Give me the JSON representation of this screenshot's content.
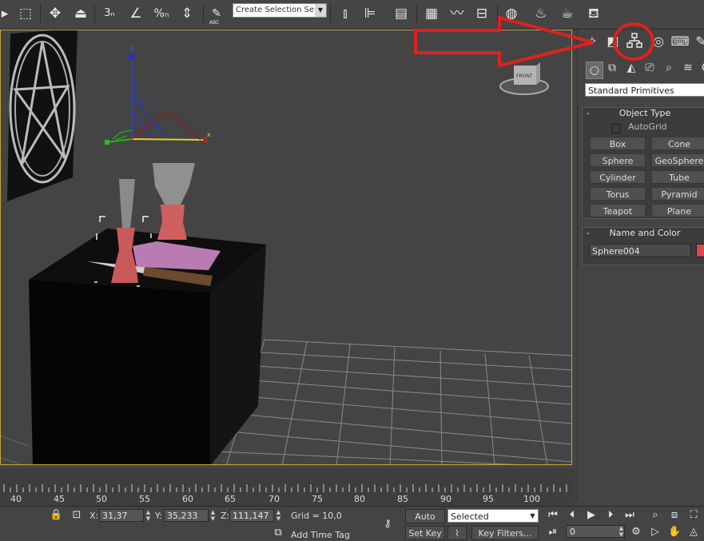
{
  "toolbar": {
    "selection_set_placeholder": "Create Selection Se",
    "snap_label": "3",
    "percent_snap_label": "%",
    "spell_label": "ABC",
    "icons": [
      "undo-icon",
      "select-region-icon",
      "move-icon",
      "select-and-place-icon",
      "snap-3d-icon",
      "angle-snap-icon",
      "percent-snap-icon",
      "spinner-snap-icon",
      "edit-named-selection-icon",
      "mirror-icon",
      "align-icon",
      "layer-manager-icon",
      "scene-explorer-icon",
      "curve-editor-icon",
      "schematic-view-icon",
      "material-editor-icon",
      "render-setup-icon",
      "rendered-frame-icon",
      "render-icon"
    ]
  },
  "viewport": {
    "axis_x": "x",
    "axis_z": "z",
    "viewcube_label": "FRONT",
    "annotation_color": "#e02020"
  },
  "command_panel": {
    "tabs": [
      "create-tab",
      "modify-tab",
      "hierarchy-tab",
      "motion-tab",
      "display-tab",
      "utilities-tab"
    ],
    "highlighted_tab": "hierarchy-tab",
    "category": "Standard Primitives",
    "object_type": {
      "title": "Object Type",
      "autogrid_label": "AutoGrid",
      "buttons": [
        "Box",
        "Cone",
        "Sphere",
        "GeoSphere",
        "Cylinder",
        "Tube",
        "Torus",
        "Pyramid",
        "Teapot",
        "Plane"
      ]
    },
    "name_and_color": {
      "title": "Name and Color",
      "name_value": "Sphere004",
      "color": "#d44c4c"
    }
  },
  "timeline": {
    "ruler_labels": [
      "40",
      "45",
      "50",
      "55",
      "60",
      "65",
      "70",
      "75",
      "80",
      "85",
      "90",
      "95",
      "100"
    ]
  },
  "status": {
    "x_label": "X:",
    "x_value": "31,37",
    "y_label": "Y:",
    "y_value": "35,233",
    "z_label": "Z:",
    "z_value": "111,147",
    "grid_label": "Grid = 10,0",
    "add_time_tag": "Add Time Tag",
    "auto_key": "Auto Key",
    "set_key": "Set Key",
    "selected_option": "Selected",
    "key_filters": "Key Filters...",
    "current_frame": "0"
  }
}
